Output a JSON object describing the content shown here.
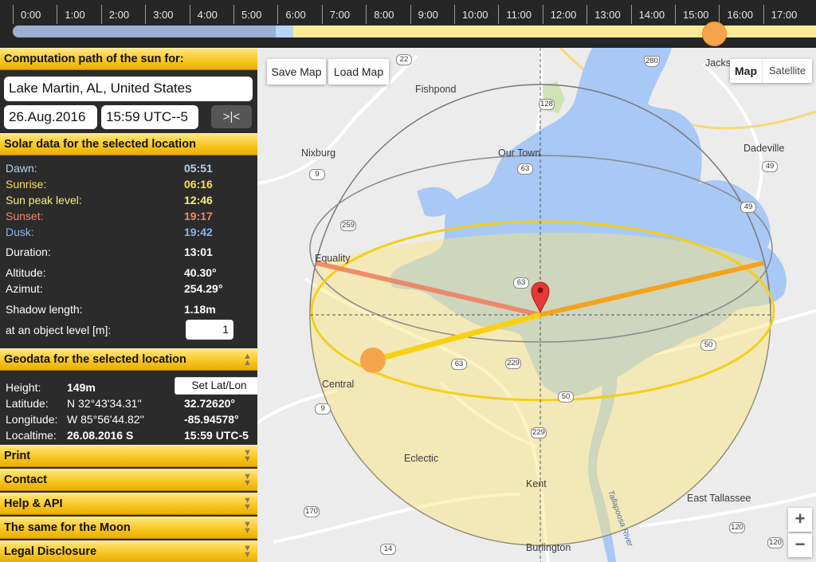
{
  "timeline": {
    "hours": [
      "0:00",
      "1:00",
      "2:00",
      "3:00",
      "4:00",
      "5:00",
      "6:00",
      "7:00",
      "8:00",
      "9:00",
      "10:00",
      "11:00",
      "12:00",
      "13:00",
      "14:00",
      "15:00",
      "16:00",
      "17:00"
    ],
    "current_position_fraction": 0.874,
    "colors": {
      "night": "#9daed0",
      "dawn": "#b7d7f3",
      "day": "#fcea98",
      "handle": "#f6a44c"
    }
  },
  "sidebar": {
    "path_header": "Computation path of the sun for:",
    "location": "Lake Martin, AL, United States",
    "date": "26.Aug.2016",
    "time": "15:59 UTC--5",
    "now_button": ">|<",
    "solar_header": "Solar data for the selected location",
    "solar": [
      {
        "label": "Dawn:",
        "value": "05:51",
        "color": "#b5d3f5"
      },
      {
        "label": "Sunrise:",
        "value": "06:16",
        "color": "#ffdf56"
      },
      {
        "label": "Sun peak level:",
        "value": "12:46",
        "color": "#f8ee7a"
      },
      {
        "label": "Sunset:",
        "value": "19:17",
        "color": "#f5866a"
      },
      {
        "label": "Dusk:",
        "value": "19:42",
        "color": "#8fb3ee"
      },
      {
        "label": "Duration:",
        "value": "13:01",
        "color": "#ffffff"
      },
      {
        "label": "Altitude:",
        "value": "40.30°",
        "color": "#ffffff"
      },
      {
        "label": "Azimut:",
        "value": "254.29°",
        "color": "#ffffff"
      },
      {
        "label": "Shadow length:",
        "value": "1.18m",
        "color": "#ffffff"
      },
      {
        "label": "at an object level [m]:",
        "value": "",
        "color": "#ffffff"
      }
    ],
    "object_level": "1",
    "geo_header": "Geodata for the selected location",
    "geo": {
      "height_label": "Height:",
      "height_value": "149m",
      "set_latlon": "Set Lat/Lon",
      "lat_label": "Latitude:",
      "lat_dms": "N 32°43'34.31''",
      "lat_dec": "32.72620°",
      "lon_label": "Longitude:",
      "lon_dms": "W 85°56'44.82''",
      "lon_dec": "-85.94578°",
      "local_label": "Localtime:",
      "local_date": "26.08.2016 S",
      "local_time": "15:59 UTC-5"
    },
    "sections": [
      "Print",
      "Contact",
      "Help & API",
      "The same for the Moon",
      "Legal Disclosure"
    ]
  },
  "map": {
    "save": "Save Map",
    "load": "Load Map",
    "type_map": "Map",
    "type_satellite": "Satellite",
    "zoom_in": "+",
    "zoom_out": "−",
    "places": [
      "Fishpond",
      "Jacks",
      "Our Town",
      "Nixburg",
      "Dadeville",
      "Equality",
      "Central",
      "Eclectic",
      "Kent",
      "East Tallassee",
      "Burlington",
      "Tallapoosa River"
    ],
    "roads": [
      "22",
      "280",
      "128",
      "63",
      "9",
      "49",
      "259",
      "63",
      "49",
      "63",
      "229",
      "50",
      "50",
      "9",
      "229",
      "170",
      "14",
      "120",
      "120"
    ],
    "colors": {
      "water": "#a8c9f5",
      "sun_band": "#fde77a",
      "sunrise_line": "#f07b5b",
      "sunset_line": "#f5a21f",
      "sun_now": "#f6a44c",
      "pin": "#e53935"
    }
  }
}
